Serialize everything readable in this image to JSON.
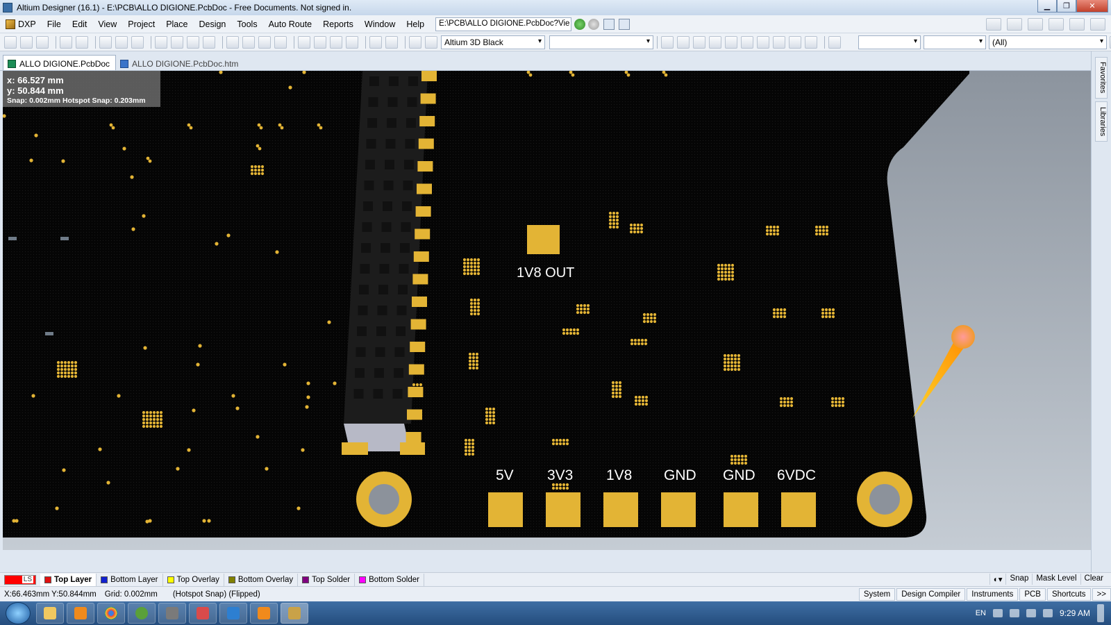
{
  "window": {
    "title": "Altium Designer (16.1) - E:\\PCB\\ALLO DIGIONE.PcbDoc - Free Documents. Not signed in."
  },
  "menu": {
    "items": [
      "DXP",
      "File",
      "Edit",
      "View",
      "Project",
      "Place",
      "Design",
      "Tools",
      "Auto Route",
      "Reports",
      "Window",
      "Help"
    ],
    "path_value": "E:\\PCB\\ALLO DIGIONE.PcbDoc?Vie"
  },
  "toolbar": {
    "view_config": "Altium 3D Black",
    "filter_value": "(All)"
  },
  "tabs": [
    "ALLO DIGIONE.PcbDoc",
    "ALLO DIGIONE.PcbDoc.htm"
  ],
  "coords": {
    "x": "x: 66.527 mm",
    "y": "y: 50.844 mm",
    "snap": "Snap: 0.002mm Hotspot Snap: 0.203mm"
  },
  "side_panel": [
    "Favorites",
    "Libraries"
  ],
  "board_labels": {
    "v18_out": "1V8  OUT",
    "pins": [
      "5V",
      "3V3",
      "1V8",
      "GND",
      "GND",
      "6VDC"
    ]
  },
  "layers": {
    "ls": "LS",
    "tabs": [
      {
        "label": "Top Layer",
        "color": "#e01010"
      },
      {
        "label": "Bottom Layer",
        "color": "#1020d0"
      },
      {
        "label": "Top Overlay",
        "color": "#ffff00"
      },
      {
        "label": "Bottom Overlay",
        "color": "#808000"
      },
      {
        "label": "Top Solder",
        "color": "#800080"
      },
      {
        "label": "Bottom Solder",
        "color": "#ff00ff"
      }
    ],
    "right": [
      "Snap",
      "Mask Level",
      "Clear"
    ]
  },
  "status": {
    "position": "X:66.463mm Y:50.844mm",
    "grid": "Grid: 0.002mm",
    "mode": "(Hotspot Snap) (Flipped)",
    "panels": [
      "System",
      "Design Compiler",
      "Instruments",
      "PCB",
      "Shortcuts",
      ">>"
    ]
  },
  "taskbar": {
    "lang": "EN",
    "time": "9:29 AM"
  },
  "colors": {
    "board": "#050505",
    "copper": "#e3b435",
    "silk": "#ffffff"
  }
}
